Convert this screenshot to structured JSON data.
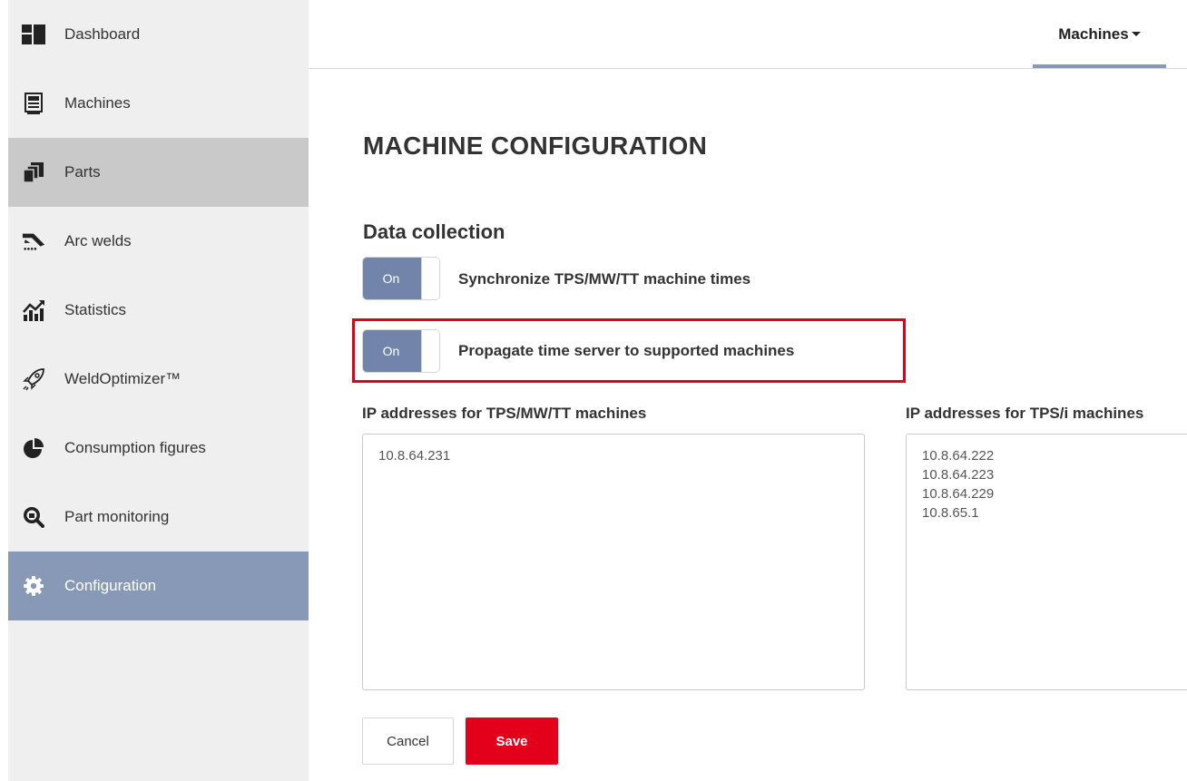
{
  "sidebar": {
    "items": [
      {
        "label": "Dashboard",
        "icon": "dashboard-icon"
      },
      {
        "label": "Machines",
        "icon": "machine-icon"
      },
      {
        "label": "Parts",
        "icon": "parts-icon"
      },
      {
        "label": "Arc welds",
        "icon": "arc-weld-icon"
      },
      {
        "label": "Statistics",
        "icon": "statistics-icon"
      },
      {
        "label": "WeldOptimizer™",
        "icon": "rocket-icon"
      },
      {
        "label": "Consumption figures",
        "icon": "pie-chart-icon"
      },
      {
        "label": "Part monitoring",
        "icon": "magnifier-icon"
      },
      {
        "label": "Configuration",
        "icon": "gear-icon"
      }
    ],
    "active_item": "Configuration",
    "hover_item": "Parts"
  },
  "header": {
    "machines_menu_label": "Machines"
  },
  "main": {
    "title": "MACHINE CONFIGURATION",
    "section_title": "Data collection",
    "toggles": [
      {
        "state_label": "On",
        "label": "Synchronize TPS/MW/TT machine times"
      },
      {
        "state_label": "On",
        "label": "Propagate time server to supported machines"
      }
    ],
    "ip_fields": [
      {
        "label": "IP addresses for TPS/MW/TT machines",
        "lines": [
          "10.8.64.231"
        ]
      },
      {
        "label": "IP addresses for TPS/i machines",
        "lines": [
          "10.8.64.222",
          "10.8.64.223",
          "10.8.64.229",
          "10.8.65.1"
        ]
      }
    ],
    "buttons": {
      "cancel_label": "Cancel",
      "save_label": "Save"
    }
  },
  "colors": {
    "sidebar_bg": "#efefef",
    "active_nav": "#8899b7",
    "toggle_on": "#7284a9",
    "save_button": "#e2001a",
    "highlight": "#e0001b"
  }
}
